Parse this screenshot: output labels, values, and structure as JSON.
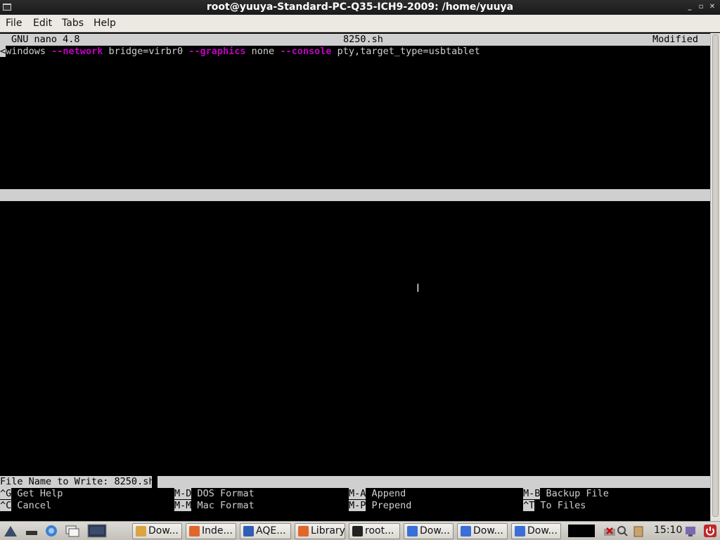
{
  "window": {
    "title": "root@yuuya-Standard-PC-Q35-ICH9-2009: /home/yuuya",
    "minimize": "_",
    "maximize": "▫",
    "close": "✕"
  },
  "menu": [
    "File",
    "Edit",
    "Tabs",
    "Help"
  ],
  "nano": {
    "version": "GNU nano 4.8",
    "filename": "8250.sh",
    "status": "Modified",
    "prompt_label": "File Name to Write: 8250.sh"
  },
  "code_line": [
    {
      "text": "<",
      "style": "hl"
    },
    {
      "text": "windows ",
      "style": ""
    },
    {
      "text": "--network",
      "style": "kw"
    },
    {
      "text": " bridge=virbr0 ",
      "style": ""
    },
    {
      "text": "--graphics",
      "style": "kw"
    },
    {
      "text": " none ",
      "style": ""
    },
    {
      "text": "--console",
      "style": "kw"
    },
    {
      "text": " pty,target_type=usbtablet",
      "style": ""
    }
  ],
  "shortcuts": {
    "row1": [
      {
        "key": "^G",
        "label": "Get Help"
      },
      {
        "key": "M-D",
        "label": "DOS Format"
      },
      {
        "key": "M-A",
        "label": "Append"
      },
      {
        "key": "M-B",
        "label": "Backup File"
      }
    ],
    "row2": [
      {
        "key": "^C",
        "label": "Cancel"
      },
      {
        "key": "M-M",
        "label": "Mac Format"
      },
      {
        "key": "M-P",
        "label": "Prepend"
      },
      {
        "key": "^T",
        "label": "To Files"
      }
    ]
  },
  "taskbar": {
    "tasks": [
      {
        "label": "Dow...",
        "icon": "folder-icon",
        "color": "#d9a441"
      },
      {
        "label": "Inde...",
        "icon": "firefox-icon",
        "color": "#e0662a"
      },
      {
        "label": "AQE...",
        "icon": "globe-icon",
        "color": "#2f5fb5"
      },
      {
        "label": "Library",
        "icon": "firefox-icon",
        "color": "#e0662a"
      },
      {
        "label": "root...",
        "icon": "terminal-icon",
        "color": "#222222"
      },
      {
        "label": "Dow...",
        "icon": "document-icon",
        "color": "#3a6fd8"
      },
      {
        "label": "Dow...",
        "icon": "document-icon",
        "color": "#3a6fd8"
      },
      {
        "label": "Dow...",
        "icon": "document-icon",
        "color": "#3a6fd8"
      }
    ],
    "clock": "15:10"
  }
}
